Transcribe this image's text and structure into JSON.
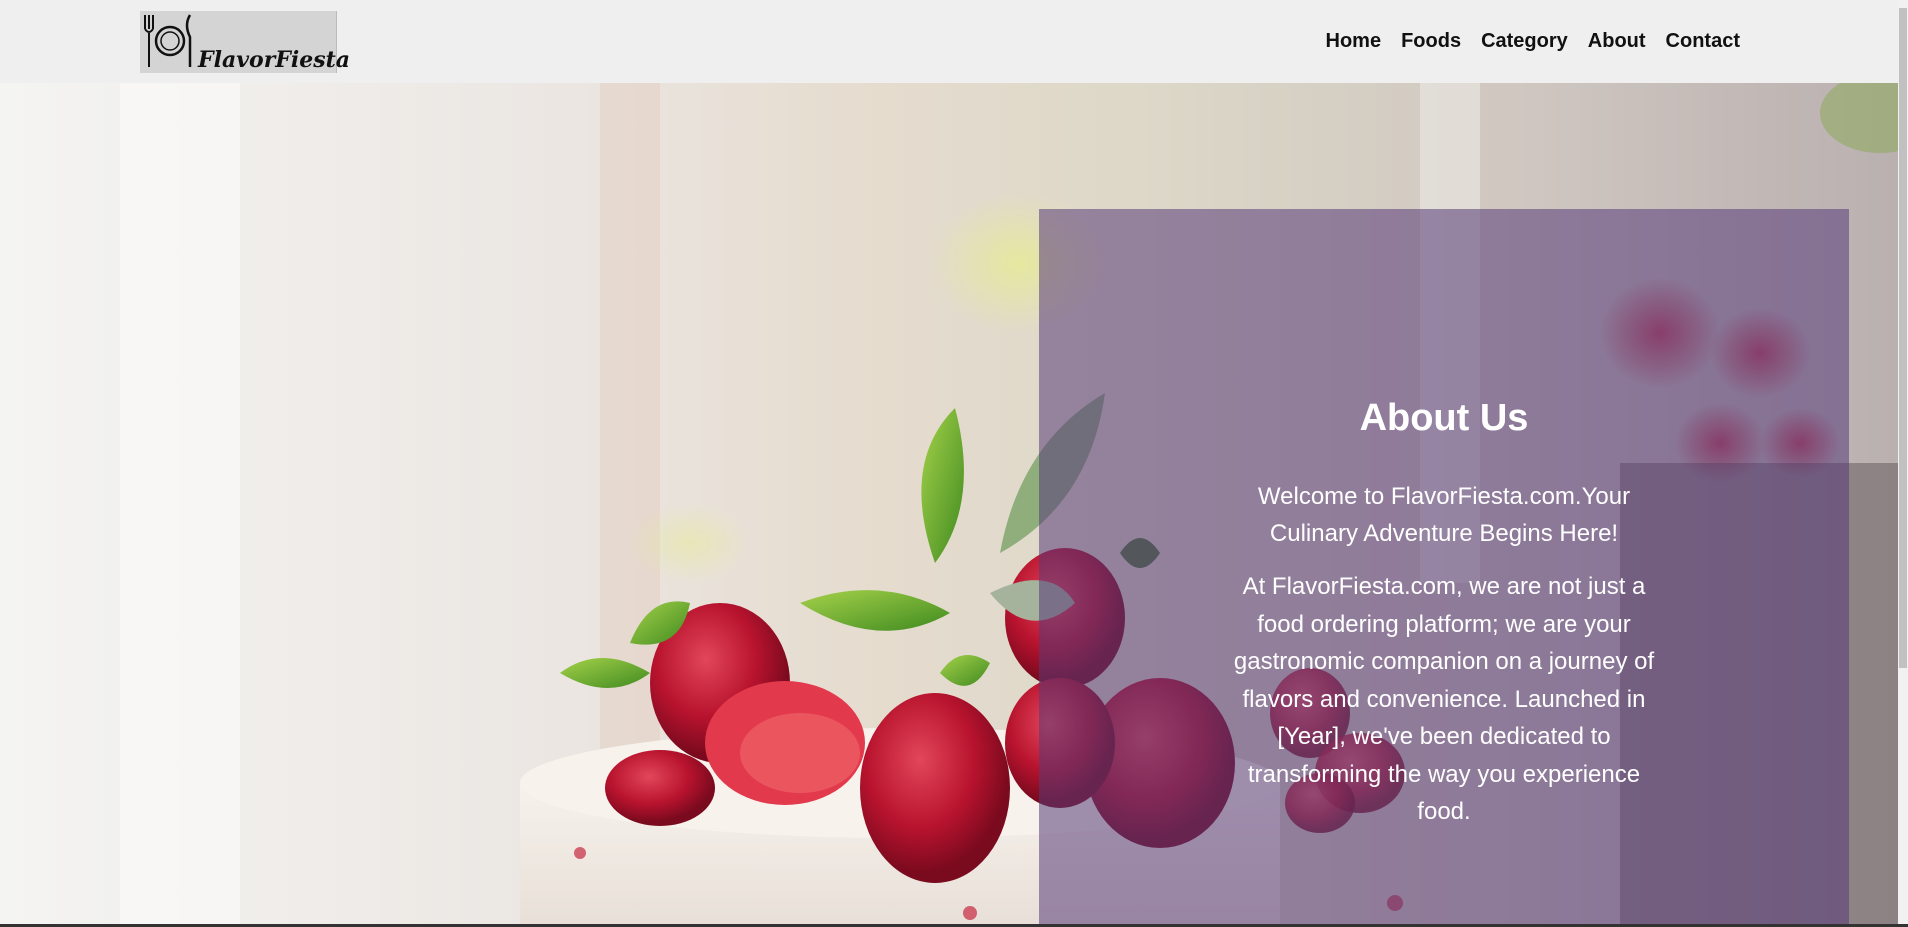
{
  "brand": {
    "name": "FlavorFiesta"
  },
  "nav": {
    "items": [
      {
        "label": "Home"
      },
      {
        "label": "Foods"
      },
      {
        "label": "Category"
      },
      {
        "label": "About"
      },
      {
        "label": "Contact"
      }
    ]
  },
  "about": {
    "title": "About Us",
    "welcome": "Welcome to FlavorFiesta.com.Your Culinary Adventure Begins Here!",
    "body": "At FlavorFiesta.com, we are not just a food ordering platform; we are your gastronomic companion on a journey of flavors and convenience. Launched in [Year], we've been dedicated to transforming the way you experience food."
  },
  "colors": {
    "header_bg": "#efefef",
    "panel_overlay": "rgba(88,58,120,0.55)",
    "nav_text": "#111111"
  },
  "icons": {
    "logo_icon": "plate-fork-knife-icon"
  }
}
